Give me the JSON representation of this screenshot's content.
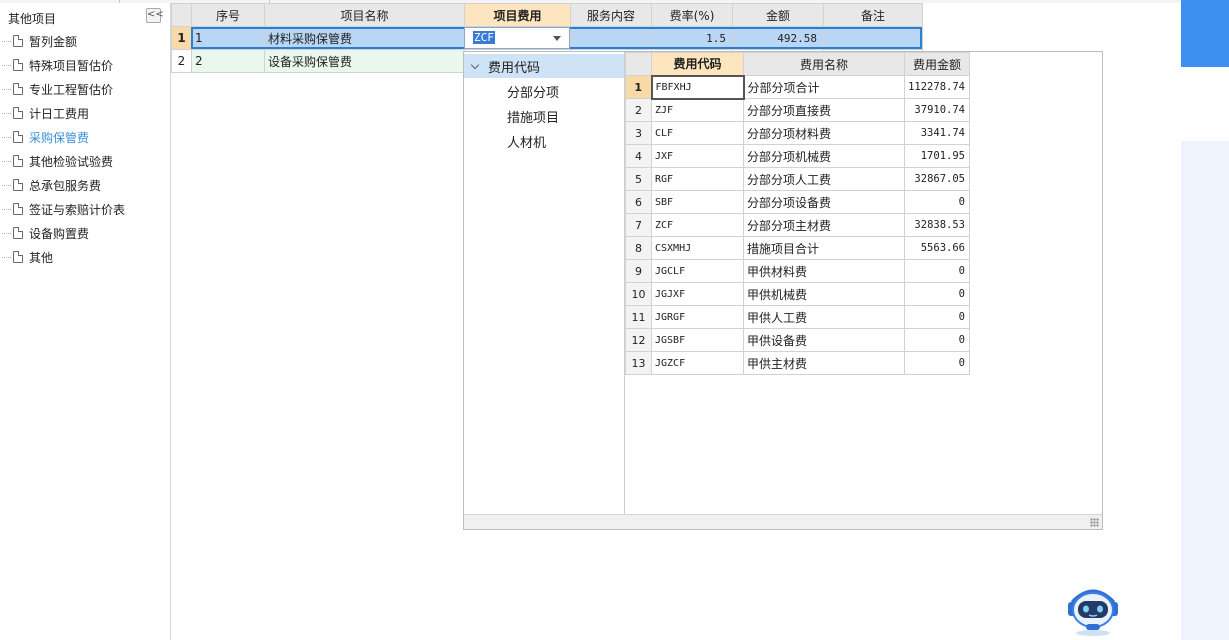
{
  "sidebar": {
    "root_label": "其他项目",
    "collapse_label": "<<",
    "items": [
      {
        "label": "暂列金额"
      },
      {
        "label": "特殊项目暂估价"
      },
      {
        "label": "专业工程暂估价"
      },
      {
        "label": "计日工费用"
      },
      {
        "label": "采购保管费",
        "active": true
      },
      {
        "label": "其他检验试验费"
      },
      {
        "label": "总承包服务费"
      },
      {
        "label": "签证与索赔计价表"
      },
      {
        "label": "设备购置费"
      },
      {
        "label": "其他"
      }
    ]
  },
  "grid": {
    "headers": [
      "序号",
      "项目名称",
      "项目费用",
      "服务内容",
      "费率(%)",
      "金额",
      "备注"
    ],
    "rows": [
      {
        "rownum": "1",
        "seq": "1",
        "name": "材料采购保管费",
        "cost": "ZCF",
        "service": "",
        "rate": "1.5",
        "amount": "492.58",
        "note": ""
      },
      {
        "rownum": "2",
        "seq": "2",
        "name": "设备采购保管费",
        "cost": "",
        "service": "",
        "rate": "",
        "amount": "",
        "note": ""
      }
    ]
  },
  "popup": {
    "tree": {
      "root": "费用代码",
      "children": [
        "分部分项",
        "措施项目",
        "人材机"
      ]
    },
    "headers": [
      "费用代码",
      "费用名称",
      "费用金额"
    ],
    "rows": [
      {
        "n": "1",
        "code": "FBFXHJ",
        "name": "分部分项合计",
        "amount": "112278.74"
      },
      {
        "n": "2",
        "code": "ZJF",
        "name": "分部分项直接费",
        "amount": "37910.74"
      },
      {
        "n": "3",
        "code": "CLF",
        "name": "分部分项材料费",
        "amount": "3341.74"
      },
      {
        "n": "4",
        "code": "JXF",
        "name": "分部分项机械费",
        "amount": "1701.95"
      },
      {
        "n": "5",
        "code": "RGF",
        "name": "分部分项人工费",
        "amount": "32867.05"
      },
      {
        "n": "6",
        "code": "SBF",
        "name": "分部分项设备费",
        "amount": "0"
      },
      {
        "n": "7",
        "code": "ZCF",
        "name": "分部分项主材费",
        "amount": "32838.53"
      },
      {
        "n": "8",
        "code": "CSXMHJ",
        "name": "措施项目合计",
        "amount": "5563.66"
      },
      {
        "n": "9",
        "code": "JGCLF",
        "name": "甲供材料费",
        "amount": "0"
      },
      {
        "n": "10",
        "code": "JGJXF",
        "name": "甲供机械费",
        "amount": "0"
      },
      {
        "n": "11",
        "code": "JGRGF",
        "name": "甲供人工费",
        "amount": "0"
      },
      {
        "n": "12",
        "code": "JGSBF",
        "name": "甲供设备费",
        "amount": "0"
      },
      {
        "n": "13",
        "code": "JGZCF",
        "name": "甲供主材费",
        "amount": "0"
      }
    ]
  },
  "colors": {
    "accent": "#3b8fd9",
    "selection": "#b9d6f5",
    "header_highlight": "#fde6bf"
  }
}
